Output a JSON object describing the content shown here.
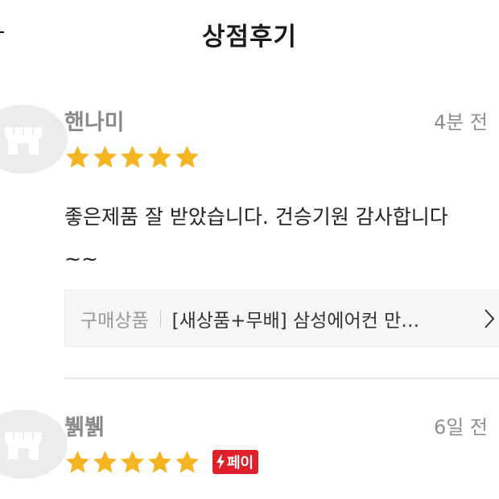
{
  "header": {
    "back_icon": "arrow-left-icon",
    "title": "상점후기"
  },
  "reviews": [
    {
      "name": "핸나미",
      "time": "4분 전",
      "avatar_icon": "store-icon",
      "rating": 5,
      "star_color": "#f5b422",
      "pay_badge": null,
      "text": "좋은제품 잘 받았습니다. 건승기원 감사합니다\n~~",
      "product": {
        "label": "구매상품",
        "name": "[새상품+무배] 삼성에어컨 만…",
        "arrow_icon": "chevron-right-icon"
      }
    },
    {
      "name": "뷁뷁",
      "time": "6일 전",
      "avatar_icon": "store-icon",
      "rating": 5,
      "star_color": "#f5b422",
      "pay_badge": {
        "label": "페이",
        "icon": "lightning-icon",
        "color": "#e0202a"
      }
    }
  ]
}
